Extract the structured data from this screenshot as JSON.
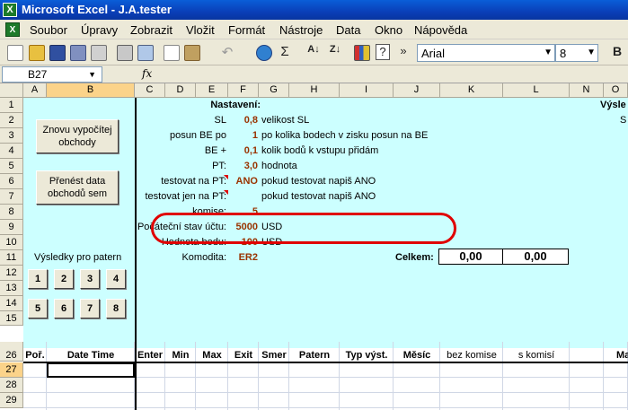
{
  "window": {
    "title": "Microsoft Excel - J.A.tester"
  },
  "menu": [
    "Soubor",
    "Úpravy",
    "Zobrazit",
    "Vložit",
    "Formát",
    "Nástroje",
    "Data",
    "Okno",
    "Nápověda"
  ],
  "toolbar": {
    "font": "Arial",
    "size": "8",
    "sigma": "Σ",
    "more": "»"
  },
  "formula": {
    "cell_ref": "B27",
    "fx": "fx",
    "content": ""
  },
  "columns": [
    "A",
    "B",
    "C",
    "D",
    "E",
    "F",
    "G",
    "H",
    "I",
    "J",
    "K",
    "L",
    "N",
    "O"
  ],
  "rows": [
    "1",
    "2",
    "3",
    "4",
    "5",
    "6",
    "7",
    "8",
    "9",
    "10",
    "11",
    "12",
    "13",
    "14",
    "15",
    "26",
    "27",
    "28",
    "29"
  ],
  "sheet": {
    "nastaveni": "Nastavení:",
    "vysledky_cut": "Výsle",
    "s_cut": "S",
    "buttons": {
      "recalc": "Znovu vypočítej obchody",
      "transfer": "Přenést data obchodů sem"
    },
    "vysledky_label": "Výsledky pro patern",
    "pattern_buttons": [
      "1",
      "2",
      "3",
      "4",
      "5",
      "6",
      "7",
      "8"
    ],
    "params": [
      {
        "label": "SL",
        "value": "0,8",
        "note": "velikost SL"
      },
      {
        "label": "posun BE po",
        "value": "1",
        "note": "po kolika bodech v zisku posun na BE"
      },
      {
        "label": "BE +",
        "value": "0,1",
        "note": "kolik bodů k vstupu přidám"
      },
      {
        "label": "PT:",
        "value": "3,0",
        "note": "hodnota"
      },
      {
        "label": "testovat na PT:",
        "value": "ANO",
        "note": "pokud testovat napiš ANO"
      },
      {
        "label": "testovat jen na PT:",
        "value": "",
        "note": "pokud testovat napiš ANO"
      },
      {
        "label": "komise:",
        "value": "5",
        "note": ""
      },
      {
        "label": "Počáteční stav účtu:",
        "value": "5000",
        "note": "USD"
      },
      {
        "label": "Hodnota bodu:",
        "value": "100",
        "note": "USD"
      },
      {
        "label": "Komodita:",
        "value": "ER2",
        "note": ""
      }
    ],
    "celkem": "Celkem:",
    "celkem_vals": [
      "0,00",
      "0,00"
    ],
    "headers26": [
      "Poř.",
      "Date Time",
      "Enter",
      "Min",
      "Max",
      "Exit",
      "Smer",
      "Patern",
      "Typ výst.",
      "Měsíc",
      "bez komise",
      "s komisí",
      "Ma"
    ]
  },
  "colors": {
    "sheet_bg": "#ccffff",
    "value": "#993300",
    "highlight": "#e00000",
    "title_bar": "#0a5ed8"
  }
}
